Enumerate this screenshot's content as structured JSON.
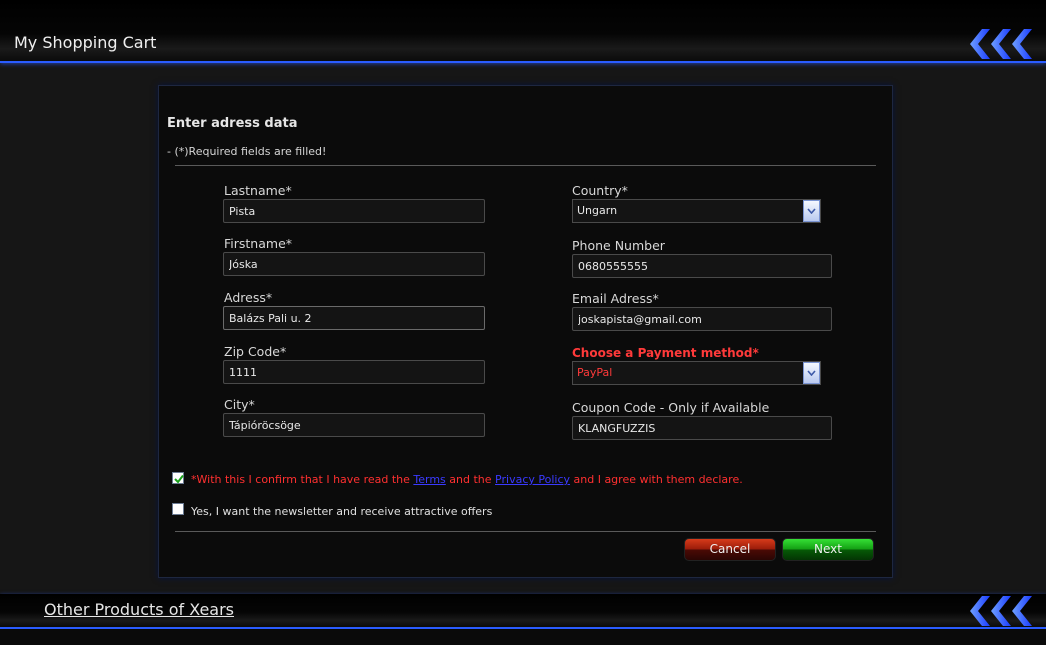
{
  "header": {
    "title": "My Shopping Cart"
  },
  "footer": {
    "link_label": "Other Products of Xears"
  },
  "form": {
    "title": "Enter adress data",
    "required_note": "- (*)Required fields are filled!",
    "lastname": {
      "label": "Lastname*",
      "value": "Pista"
    },
    "firstname": {
      "label": "Firstname*",
      "value": "Jóska"
    },
    "address": {
      "label": "Adress*",
      "value": "Balázs Pali u. 2"
    },
    "zip": {
      "label": "Zip Code*",
      "value": "1111"
    },
    "city": {
      "label": "City*",
      "value": "Tápióröcsöge"
    },
    "country": {
      "label": "Country*",
      "value": "Ungarn"
    },
    "phone": {
      "label": "Phone Number",
      "value": "0680555555"
    },
    "email": {
      "label": "Email Adress*",
      "value": "joskapista@gmail.com"
    },
    "payment": {
      "label": "Choose a Payment method*",
      "value": "PayPal"
    },
    "coupon": {
      "label": "Coupon Code - Only if Available",
      "value": "KLANGFUZZIS"
    }
  },
  "consent": {
    "checked": true,
    "prefix": "*With this I confirm that I have read the ",
    "terms_link": "Terms",
    "middle": " and the ",
    "privacy_link": "Privacy Policy",
    "suffix": " and I agree with them declare."
  },
  "newsletter": {
    "checked": false,
    "label": "Yes, I want the newsletter and receive attractive offers"
  },
  "buttons": {
    "cancel": "Cancel",
    "next": "Next"
  },
  "colors": {
    "accent_blue": "#2a5cff",
    "error_red": "#ff3a3a",
    "link_blue": "#3a3aff",
    "cancel_red": "#9a1c0a",
    "next_green": "#14a014"
  },
  "icons": {
    "header_logo": "triple-chevron-left-icon",
    "select_arrow": "chevron-down-icon",
    "check": "checkmark-icon"
  }
}
